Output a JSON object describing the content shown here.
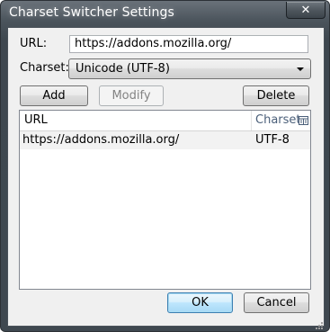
{
  "window": {
    "title": "Charset Switcher Settings",
    "close_glyph": "✕"
  },
  "form": {
    "url_label": "URL:",
    "url_value": "https://addons.mozilla.org/",
    "charset_label": "Charset:",
    "charset_selected": "Unicode (UTF-8)"
  },
  "actions": {
    "add_label": "Add",
    "modify_label": "Modify",
    "delete_label": "Delete"
  },
  "list": {
    "columns": [
      "URL",
      "Charset"
    ],
    "rows": [
      {
        "url": "https://addons.mozilla.org/",
        "charset": "UTF-8"
      }
    ]
  },
  "dialog": {
    "ok_label": "OK",
    "cancel_label": "Cancel"
  },
  "icons": {
    "close": "close-icon",
    "dropdown": "chevron-down-icon",
    "column_picker": "column-picker-icon",
    "resize": "resize-grip-icon"
  },
  "colors": {
    "frame": "#3f4850",
    "client_bg": "#f0f0f0",
    "default_button_border": "#3c7fb1",
    "header_text": "#4c607a"
  }
}
